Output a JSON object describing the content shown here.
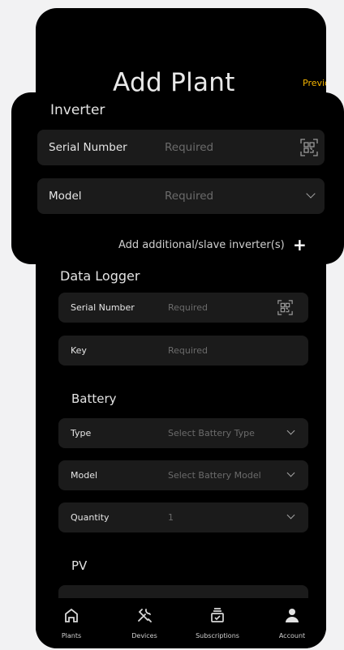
{
  "header": {
    "title": "Add Plant",
    "previous_label": "Previous"
  },
  "inverter": {
    "section_label": "Inverter",
    "serial": {
      "label": "Serial Number",
      "placeholder": "Required",
      "icon": "qr-scan-icon"
    },
    "model": {
      "label": "Model",
      "placeholder": "Required",
      "icon": "chevron-down-icon"
    },
    "add_label": "Add additional/slave inverter(s)",
    "add_icon": "+"
  },
  "data_logger": {
    "section_label": "Data Logger",
    "serial": {
      "label": "Serial Number",
      "placeholder": "Required",
      "icon": "qr-scan-icon"
    },
    "key": {
      "label": "Key",
      "placeholder": "Required"
    }
  },
  "battery": {
    "section_label": "Battery",
    "type": {
      "label": "Type",
      "placeholder": "Select Battery Type"
    },
    "model": {
      "label": "Model",
      "placeholder": "Select Battery Model"
    },
    "quantity": {
      "label": "Quantity",
      "value": "1"
    }
  },
  "pv": {
    "section_label": "PV"
  },
  "tabbar": {
    "tabs": [
      {
        "label": "Plants",
        "icon": "home-icon"
      },
      {
        "label": "Devices",
        "icon": "tools-icon"
      },
      {
        "label": "Subscriptions",
        "icon": "subscriptions-icon"
      },
      {
        "label": "Account",
        "icon": "account-icon"
      }
    ]
  },
  "colors": {
    "background": "#000000",
    "field": "#1b1b1b",
    "accent": "#f5b400",
    "placeholder": "#6b6b6b"
  }
}
